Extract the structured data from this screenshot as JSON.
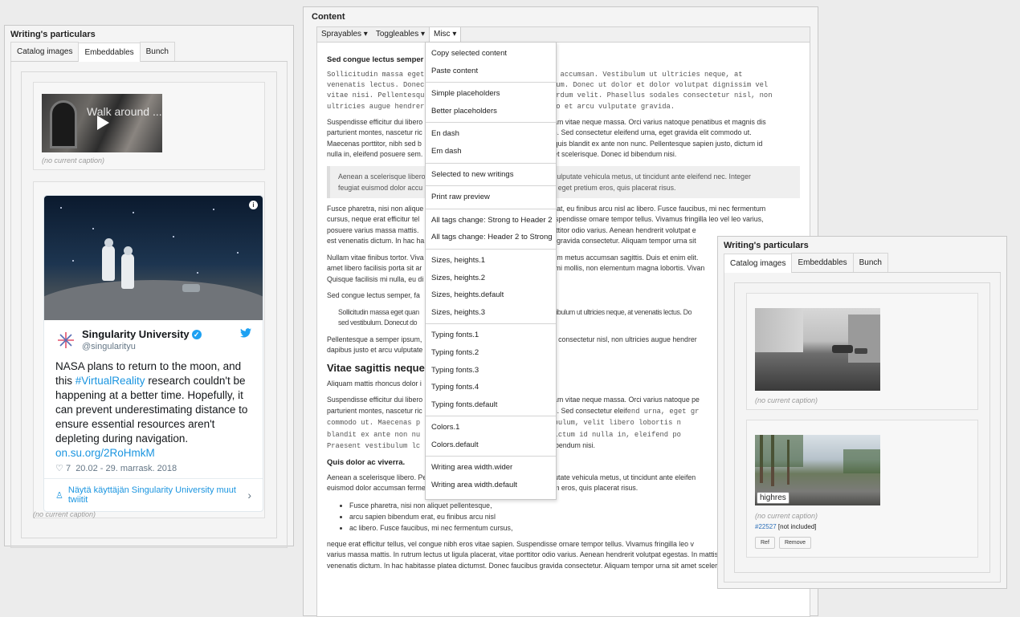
{
  "left_panel": {
    "title": "Writing's particulars",
    "tabs": [
      "Catalog images",
      "Embeddables",
      "Bunch"
    ],
    "video": {
      "title": "Walk around ..."
    },
    "caption_1": "(no current caption)",
    "caption_2": "(no current caption)",
    "tweet": {
      "name": "Singularity University",
      "handle": "@singularityu",
      "text_1": "NASA plans to return to the moon, and this ",
      "hashtag": "#VirtualReality",
      "text_2": " research couldn't be happening at a better time. Hopefully, it can prevent underestimating distance to ensure essential resources aren't depleting during navigation. ",
      "link": "on.su.org/2RoHmkM",
      "likes": "7",
      "date": "20.02 - 29. marrask. 2018",
      "more": "Näytä käyttäjän Singularity University muut twiitit"
    }
  },
  "content": {
    "title": "Content",
    "toolbar": [
      "Sprayables ▾",
      "Toggleables ▾",
      "Misc ▾"
    ],
    "h_1": "Sed congue lectus semper",
    "h_1_tail": ".",
    "p_mono_1": "Sollicitudin massa eget",
    "p_mono_1_tail": "rci accumsan. Vestibulum ut ultricies neque, at",
    "p_mono_2": "venenatis lectus. Donec",
    "p_mono_2_tail": "bulum. Donec ut dolor et dolor volutpat dignissim vel",
    "p_mono_3": "vitae nisi. Pellentesqu",
    "p_mono_3_tail": "nterdum velit. Phasellus sodales consectetur nisl, non",
    "p_mono_4": "ultricies augue hendrer",
    "p_mono_4_tail": "usto et arcu vulputate gravida.",
    "p2_a": "Suspendisse efficitur dui libero",
    "p2_a_tail": "uam vitae neque massa. Orci varius natoque penatibus et magnis dis",
    "p2_b": "parturient montes, nascetur ric",
    "p2_b_tail": "bh. Sed consectetur eleifend urna, eget gravida elit commodo ut.",
    "p2_c": "Maecenas porttitor, nibh sed b",
    "p2_c_tail": "l, quis blandit ex ante non nunc. Pellentesque sapien justo, dictum id",
    "p2_d": "nulla in, eleifend posuere sem.",
    "p2_d_tail": "uet scelerisque. Donec id bibendum nisi.",
    "quote_a": "Aenean a scelerisque libero",
    "quote_a_tail": "d vulputate vehicula metus, ut tincidunt ante eleifend nec. Integer",
    "quote_b": "feugiat euismod dolor accu",
    "quote_b_tail": "sed eget pretium eros, quis placerat risus.",
    "p3_a": "Fusce pharetra, nisi non alique",
    "p3_a_tail": "erat, eu finibus arcu nisl ac libero. Fusce faucibus, mi nec fermentum",
    "p3_b": "cursus, neque erat efficitur tel",
    "p3_b_tail": "Suspendisse ornare tempor tellus. Vivamus fringilla leo vel leo varius,",
    "p3_c": "posuere varius massa mattis.",
    "p3_c_tail": "porttitor odio varius. Aenean hendrerit volutpat e",
    "p3_d": "est venenatis dictum. In hac ha",
    "p3_d_tail": "s gravida consectetur. Aliquam tempor urna sit",
    "p4_a": "Nullam vitae finibus tortor. Viva",
    "p4_a_tail": "rum metus accumsan sagittis. Duis et enim elit.",
    "p4_b": "amet libero facilisis porta sit ar",
    "p4_b_tail": "u mi mollis, non elementum magna lobortis. Vivan",
    "p4_c": "Quisque facilisis mi nulla, eu di",
    "p5": "Sed congue lectus semper, fa",
    "p6_a": "Sollicitudin massa eget quan",
    "p6_a_tail": "estibulum ut ultricies neque, at venenatis lectus. Do",
    "p6_b": "sed vestibulum. Donecut do",
    "p7_a": "Pellentesque a semper ipsum,",
    "p7_a_tail": "es consectetur nisl, non ultricies augue hendrer",
    "p7_b": "dapibus justo et arcu vulputate",
    "h2": "Vitae sagittis neque.",
    "p8": "Aliquam mattis rhoncus dolor i",
    "p9_a": "Suspendisse efficitur dui libero",
    "p9_a_tail": "uam vitae neque massa. Orci varius natoque pe",
    "p9_b": "parturient montes, nascetur ric",
    "p9_b_tail": "bh. Sed consectetur eleif",
    "p9_b_mono": "end urna, eget gr",
    "p9_c": "commodo ut. Maecenas p",
    "p9_c_tail": "vestibulum, velit libero lobortis n",
    "p9_d": "blandit ex ante non nu",
    "p9_d_tail": "to, dictum id nulla in, eleifend po",
    "p9_e": "Praesent vestibulum lc",
    "p9_e_tail": "ec id bibendum nisi.",
    "h4": "Quis dolor ac viverra.",
    "p10_a": "Aenean a scelerisque libero. Pellentesque eget hendrerit lacus. Sed vulputate vehicula metus, ut tincidunt ante eleifen",
    "p10_b": "euismod dolor accumsan fermentum. Duis a ornare erat. Sed eget pretium eros, quis placerat risus.",
    "bullets": [
      "Fusce pharetra, nisi non aliquet pellentesque,",
      "arcu sapien bibendum erat, eu finibus arcu nisl",
      "ac libero. Fusce faucibus, mi nec fermentum cursus,"
    ],
    "p11_a": "neque erat efficitur tellus, vel congue nibh eros vitae sapien. Suspendisse ornare tempor tellus. Vivamus fringilla leo v",
    "p11_b": "varius massa mattis. In rutrum lectus ut ligula placerat, vitae porttitor odio varius. Aenean hendrerit volutpat egestas. In mattis ex in est",
    "p11_c": "venenatis dictum. In hac habitasse platea dictumst. Donec faucibus gravida consectetur. Aliquam tempor urna sit amet scelerisque lacinia."
  },
  "misc_menu": {
    "groups": [
      [
        "Copy selected content",
        "Paste content"
      ],
      [
        "Simple placeholders",
        "Better placeholders"
      ],
      [
        "En dash",
        "Em dash"
      ],
      [
        "Selected to new writings"
      ],
      [
        "Print raw preview"
      ],
      [
        "All tags change: Strong to Header 2",
        "All tags change: Header 2 to Strong"
      ],
      [
        "Sizes, heights.1",
        "Sizes, heights.2",
        "Sizes, heights.default",
        "Sizes, heights.3"
      ],
      [
        "Typing fonts.1",
        "Typing fonts.2",
        "Typing fonts.3",
        "Typing fonts.4",
        "Typing fonts.default"
      ],
      [
        "Colors.1",
        "Colors.default"
      ],
      [
        "Writing area width.wider",
        "Writing area width.default"
      ]
    ]
  },
  "right_panel": {
    "title": "Writing's particulars",
    "tabs": [
      "Catalog images",
      "Embeddables",
      "Bunch"
    ],
    "caption_1": "(no current caption)",
    "label": "highres",
    "caption_2": "(no current caption)",
    "ref_id": "#22527",
    "ref_status": " [not included]",
    "buttons": [
      "Ref",
      "Remove"
    ]
  },
  "colors": {
    "link": "#1b95e0",
    "twitter": "#1da1f2",
    "accent": "#2b6fb8"
  }
}
